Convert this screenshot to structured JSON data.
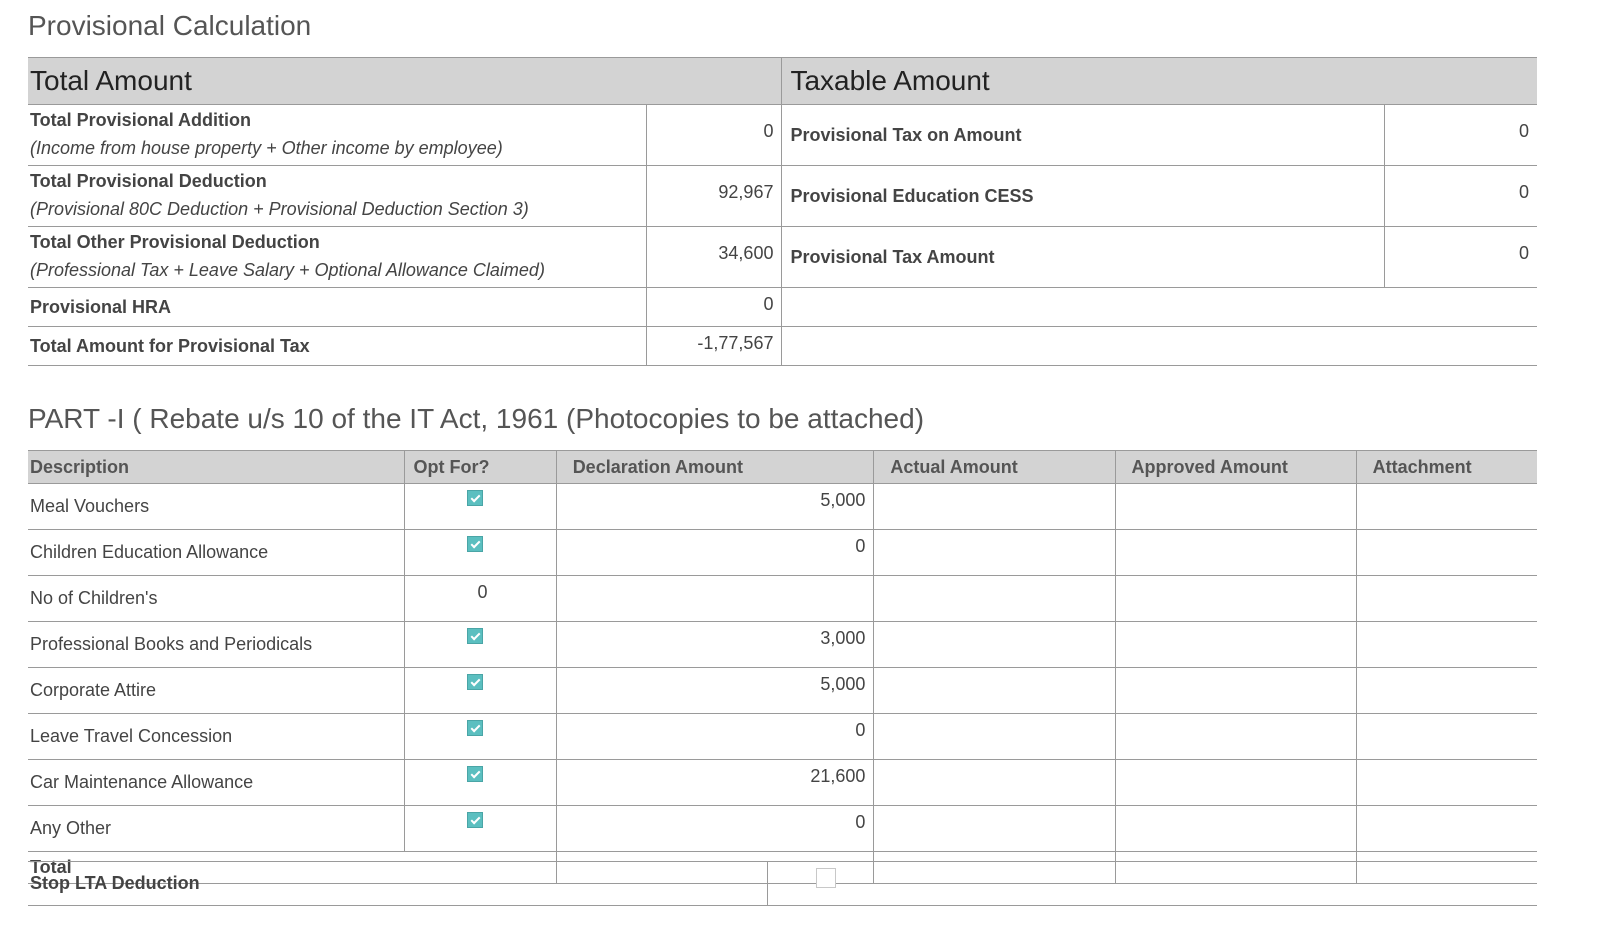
{
  "provisional": {
    "title": "Provisional Calculation",
    "total_header": "Total Amount",
    "taxable_header": "Taxable Amount",
    "rows": [
      {
        "label": "Total Provisional Addition",
        "sub": "(Income from house property + Other income by employee)",
        "value": "0",
        "tax_label": "Provisional Tax on Amount",
        "tax_value": "0"
      },
      {
        "label": "Total Provisional Deduction",
        "sub": "(Provisional 80C Deduction + Provisional Deduction Section 3)",
        "value": "92,967",
        "tax_label": "Provisional Education CESS",
        "tax_value": "0"
      },
      {
        "label": "Total Other Provisional Deduction",
        "sub": "(Professional Tax + Leave Salary + Optional Allowance Claimed)",
        "value": "34,600",
        "tax_label": "Provisional Tax Amount",
        "tax_value": "0"
      },
      {
        "label": "Provisional HRA",
        "value": "0"
      },
      {
        "label": "Total Amount for Provisional Tax",
        "value": "-1,77,567"
      }
    ]
  },
  "part1": {
    "title": "PART -I ( Rebate u/s 10 of the IT Act, 1961 (Photocopies to be attached)",
    "columns": [
      "Description",
      "Opt For?",
      "Declaration Amount",
      "Actual Amount",
      "Approved Amount",
      "Attachment"
    ],
    "rows": [
      {
        "description": "Meal Vouchers",
        "opt": true,
        "declaration": "5,000"
      },
      {
        "description": "Children Education Allowance",
        "opt": true,
        "declaration": "0"
      },
      {
        "description": "No of Children's",
        "count": "0"
      },
      {
        "description": "Professional Books and Periodicals",
        "opt": true,
        "declaration": "3,000"
      },
      {
        "description": "Corporate Attire",
        "opt": true,
        "declaration": "5,000"
      },
      {
        "description": "Leave Travel Concession",
        "opt": true,
        "declaration": "0"
      },
      {
        "description": "Car Maintenance Allowance",
        "opt": true,
        "declaration": "21,600"
      },
      {
        "description": "Any Other",
        "opt": true,
        "declaration": "0"
      }
    ],
    "total_label": "Total"
  },
  "lta": {
    "label": "Stop LTA Deduction",
    "checked": false
  },
  "colors": {
    "header_bg": "#d3d3d3",
    "border": "#9a9a9a",
    "checkbox": "#5bbfc0",
    "text": "#444444"
  }
}
